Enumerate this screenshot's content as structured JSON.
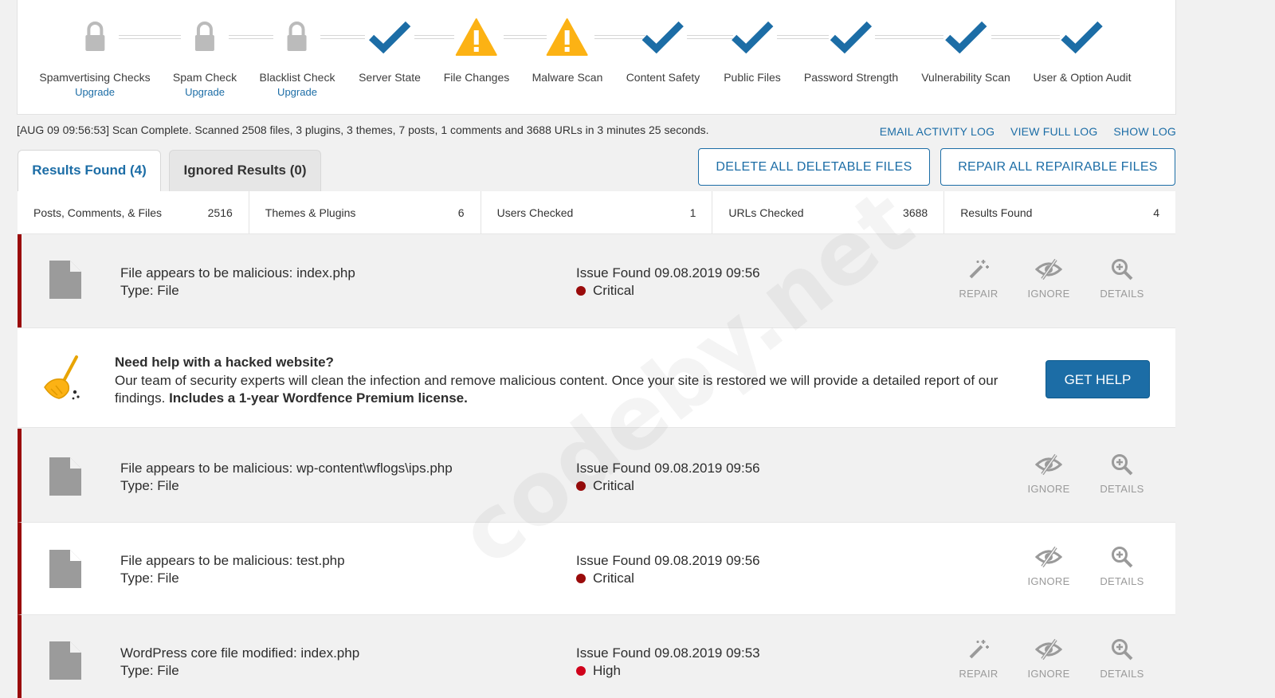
{
  "stages": [
    {
      "label": "Spamvertising Checks",
      "status": "locked",
      "upgrade": "Upgrade"
    },
    {
      "label": "Spam Check",
      "status": "locked",
      "upgrade": "Upgrade"
    },
    {
      "label": "Blacklist Check",
      "status": "locked",
      "upgrade": "Upgrade"
    },
    {
      "label": "Server State",
      "status": "complete"
    },
    {
      "label": "File Changes",
      "status": "warning"
    },
    {
      "label": "Malware Scan",
      "status": "warning"
    },
    {
      "label": "Content Safety",
      "status": "complete"
    },
    {
      "label": "Public Files",
      "status": "complete"
    },
    {
      "label": "Password Strength",
      "status": "complete"
    },
    {
      "label": "Vulnerability Scan",
      "status": "complete"
    },
    {
      "label": "User & Option Audit",
      "status": "complete"
    }
  ],
  "status_line": "[AUG 09 09:56:53] Scan Complete. Scanned 2508 files, 3 plugins, 3 themes, 7 posts, 1 comments and 3688 URLs in 3 minutes 25 seconds.",
  "log_links": {
    "email": "EMAIL ACTIVITY LOG",
    "full": "VIEW FULL LOG",
    "show": "SHOW LOG"
  },
  "tabs": {
    "results": "Results Found (4)",
    "ignored": "Ignored Results (0)"
  },
  "buttons": {
    "delete_all": "DELETE ALL DELETABLE FILES",
    "repair_all": "REPAIR ALL REPAIRABLE FILES"
  },
  "stats": [
    {
      "label": "Posts, Comments, & Files",
      "value": "2516"
    },
    {
      "label": "Themes & Plugins",
      "value": "6"
    },
    {
      "label": "Users Checked",
      "value": "1"
    },
    {
      "label": "URLs Checked",
      "value": "3688"
    },
    {
      "label": "Results Found",
      "value": "4"
    }
  ],
  "issues": [
    {
      "title": "File appears to be malicious: index.php",
      "type": "Type: File",
      "found": "Issue Found 09.08.2019 09:56",
      "severity": "Critical"
    },
    {
      "title": "File appears to be malicious: wp-content\\wflogs\\ips.php",
      "type": "Type: File",
      "found": "Issue Found 09.08.2019 09:56",
      "severity": "Critical"
    },
    {
      "title": "File appears to be malicious: test.php",
      "type": "Type: File",
      "found": "Issue Found 09.08.2019 09:56",
      "severity": "Critical"
    },
    {
      "title": "WordPress core file modified: index.php",
      "type": "Type: File",
      "found": "Issue Found 09.08.2019 09:53",
      "severity": "High"
    }
  ],
  "actions": {
    "repair": "REPAIR",
    "ignore": "IGNORE",
    "details": "DETAILS"
  },
  "help": {
    "title": "Need help with a hacked website?",
    "body": "Our team of security experts will clean the infection and remove malicious content. Once your site is restored we will provide a detailed report of our findings.",
    "bold": "Includes a 1-year Wordfence Premium license.",
    "button": "GET HELP"
  },
  "watermark": "codeby.net",
  "colors": {
    "accent": "#1c6da6",
    "critical": "#9a0b0b",
    "high": "#d0021b",
    "warning": "#fcb214",
    "locked": "#bbbbbb"
  }
}
